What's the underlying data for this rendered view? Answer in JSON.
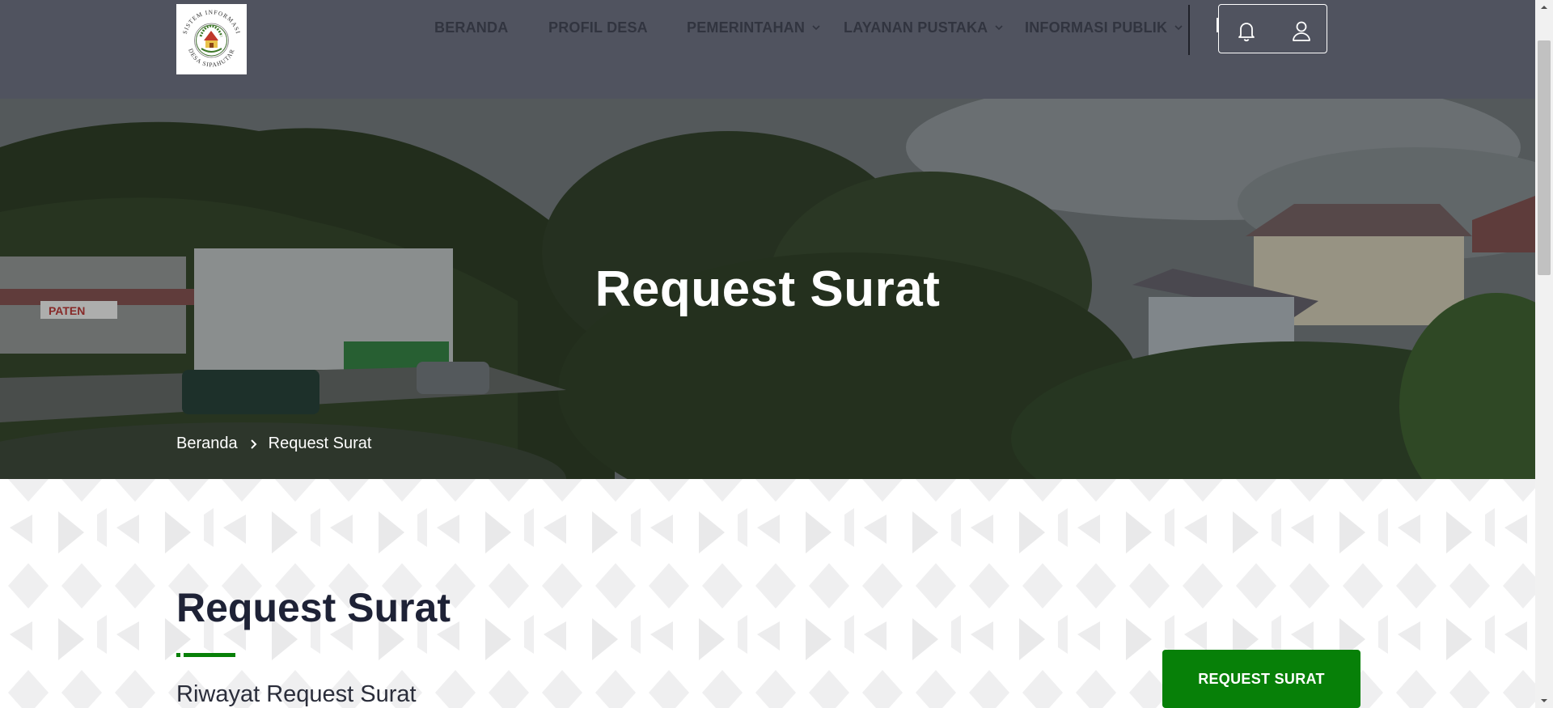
{
  "header": {
    "logo_text_top": "SISTEM INFORMASI",
    "logo_text_bottom": "DESA SIPAHUTAR",
    "nav": [
      {
        "label": "BERANDA",
        "has_dropdown": false
      },
      {
        "label": "PROFIL DESA",
        "has_dropdown": false
      },
      {
        "label": "PEMERINTAHAN",
        "has_dropdown": true
      },
      {
        "label": "LAYANAN PUSTAKA",
        "has_dropdown": true
      },
      {
        "label": "INFORMASI PUBLIK",
        "has_dropdown": true
      }
    ],
    "icons": [
      "bell-icon",
      "user-icon"
    ]
  },
  "hero": {
    "title": "Request Surat",
    "breadcrumb": [
      "Beranda",
      "Request Surat"
    ],
    "shop_sign": "PATEN"
  },
  "main": {
    "section_title": "Request Surat",
    "subtitle": "Riwayat Request Surat",
    "request_button": "REQUEST SURAT"
  },
  "colors": {
    "header_bg": "#50535f",
    "nav_text": "#31343f",
    "accent_green": "#078008",
    "title_dark": "#1e2236"
  }
}
